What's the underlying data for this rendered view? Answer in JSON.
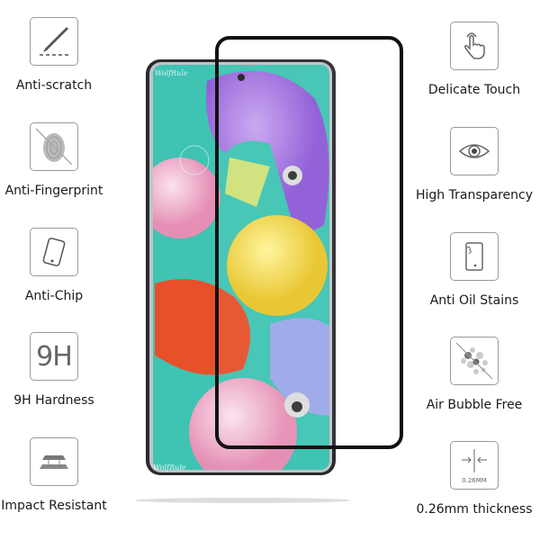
{
  "left_features": [
    {
      "label": "Anti-scratch",
      "icon": "blade-scratch-icon"
    },
    {
      "label": "Anti-Fingerprint",
      "icon": "fingerprint-crossed-icon"
    },
    {
      "label": "Anti-Chip",
      "icon": "tilted-phone-icon"
    },
    {
      "label": "9H Hardness",
      "icon": "9h-icon",
      "icon_text": "9H"
    },
    {
      "label": "Impact Resistant",
      "icon": "layers-icon"
    }
  ],
  "right_features": [
    {
      "label": "Delicate Touch",
      "icon": "touch-hand-icon"
    },
    {
      "label": "High Transparency",
      "icon": "eye-icon"
    },
    {
      "label": "Anti Oil Stains",
      "icon": "phone-stain-icon"
    },
    {
      "label": "Air Bubble Free",
      "icon": "bubbles-crossed-icon"
    },
    {
      "label": "0.26mm thickness",
      "icon": "thickness-icon",
      "icon_text": "0.26MM"
    }
  ],
  "watermark": "WolfRule",
  "colors": {
    "screen": "#3fc3b3",
    "glass_border": "#111111",
    "icon_border": "#9a9a9a"
  }
}
